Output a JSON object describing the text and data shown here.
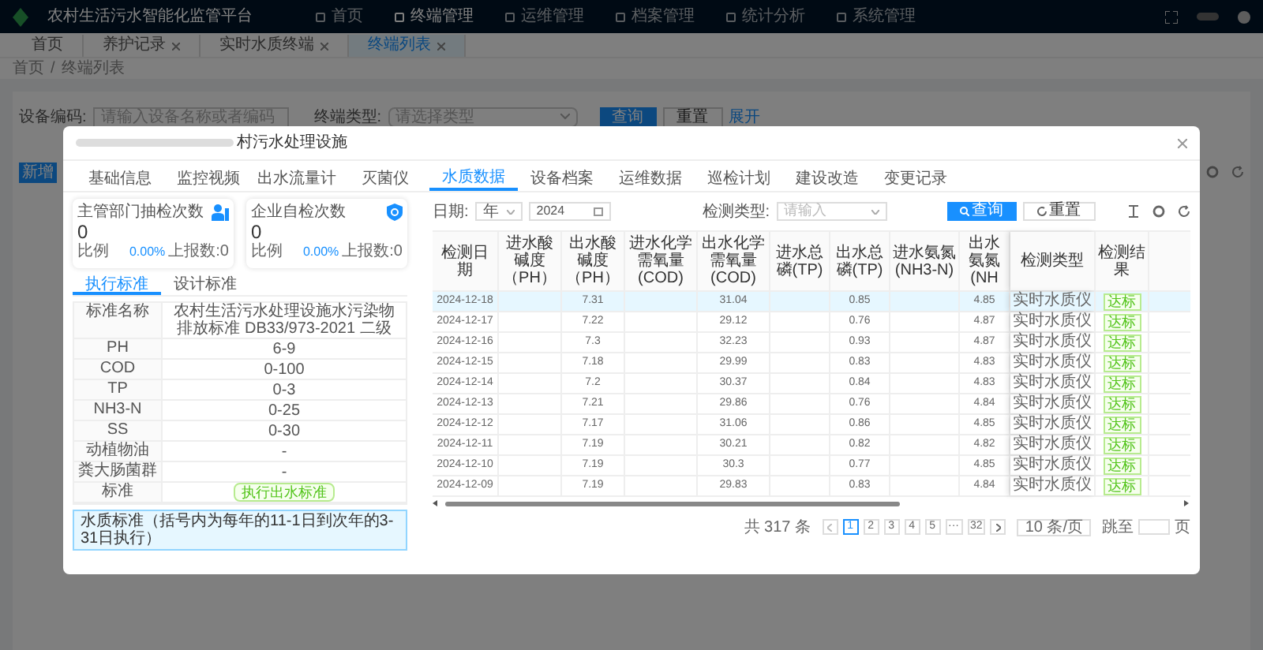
{
  "app": {
    "title": "农村生活污水智能化监管平台",
    "nav": [
      {
        "label": "首页",
        "selected": false
      },
      {
        "label": "终端管理",
        "selected": true
      },
      {
        "label": "运维管理",
        "selected": false
      },
      {
        "label": "档案管理",
        "selected": false
      },
      {
        "label": "统计分析",
        "selected": false
      },
      {
        "label": "系统管理",
        "selected": false
      }
    ]
  },
  "page_tabs": [
    {
      "label": "首页",
      "closable": false,
      "selected": false
    },
    {
      "label": "养护记录",
      "closable": true,
      "selected": false
    },
    {
      "label": "实时水质终端",
      "closable": true,
      "selected": false
    },
    {
      "label": "终端列表",
      "closable": true,
      "selected": true
    }
  ],
  "breadcrumb": {
    "items": [
      "首页",
      "终端列表"
    ],
    "separator": "/"
  },
  "filters": [
    {
      "label": "设备编码:",
      "placeholder": "请输入设备名称或者编码",
      "kind": "text"
    },
    {
      "label": "终端类型:",
      "placeholder": "请选择类型",
      "kind": "select"
    }
  ],
  "filter_buttons": {
    "search": "查询",
    "reset": "重置",
    "expand": "展开"
  },
  "add_button": "新增",
  "modal": {
    "title": "村污水处理设施",
    "tabs": [
      {
        "label": "基础信息",
        "selected": false
      },
      {
        "label": "监控视频",
        "selected": false
      },
      {
        "label": "出水流量计",
        "selected": false
      },
      {
        "label": "灭菌仪",
        "selected": false
      },
      {
        "label": "水质数据",
        "selected": true
      },
      {
        "label": "设备档案",
        "selected": false
      },
      {
        "label": "运维数据",
        "selected": false
      },
      {
        "label": "巡检计划",
        "selected": false
      },
      {
        "label": "建设改造",
        "selected": false
      },
      {
        "label": "变更记录",
        "selected": false
      }
    ],
    "stat_cards": [
      {
        "title": "主管部门抽检次数",
        "value": "0",
        "ratio_label": "比例",
        "ratio": "0.00%",
        "reported": "上报数:0"
      },
      {
        "title": "企业自检次数",
        "value": "0",
        "ratio_label": "比例",
        "ratio": "0.00%",
        "reported": "上报数:0"
      }
    ],
    "standard_tabs": [
      {
        "label": "执行标准",
        "selected": true
      },
      {
        "label": "设计标准",
        "selected": false
      }
    ],
    "standards": [
      {
        "label": "标准名称",
        "value": "农村生活污水处理设施水污染物排放标准 DB33/973-2021 二级",
        "kind": "text"
      },
      {
        "label": "PH",
        "value": "6-9",
        "kind": "text"
      },
      {
        "label": "COD",
        "value": "0-100",
        "kind": "text"
      },
      {
        "label": "TP",
        "value": "0-3",
        "kind": "text"
      },
      {
        "label": "NH3-N",
        "value": "0-25",
        "kind": "text"
      },
      {
        "label": "SS",
        "value": "0-30",
        "kind": "text"
      },
      {
        "label": "动植物油",
        "value": "-",
        "kind": "text"
      },
      {
        "label": "粪大肠菌群",
        "value": "-",
        "kind": "text"
      },
      {
        "label": "标准",
        "value": "执行出水标准",
        "kind": "tag"
      }
    ],
    "note": "水质标准（括号内为每年的11-1日到次年的3-31日执行）",
    "query": {
      "date_label": "日期:",
      "period": "年",
      "year": "2024",
      "type_label": "检测类型:",
      "type_placeholder": "请输入",
      "search": "查询",
      "reset": "重置"
    },
    "columns": [
      "检测日期",
      "进水酸碱度（PH）",
      "出水酸碱度（PH）",
      "进水化学需氧量(COD)",
      "出水化学需氧量(COD)",
      "进水总磷(TP)",
      "出水总磷(TP)",
      "进水氨氮(NH3-N)",
      "出水氨氮(NH",
      "检测类型",
      "检测结果"
    ],
    "rows": [
      {
        "cells": [
          "2024-12-18",
          "",
          "7.31",
          "",
          "31.04",
          "",
          "0.85",
          "",
          "4.85",
          "实时水质仪",
          "达标"
        ],
        "selected": true
      },
      {
        "cells": [
          "2024-12-17",
          "",
          "7.22",
          "",
          "29.12",
          "",
          "0.76",
          "",
          "4.87",
          "实时水质仪",
          "达标"
        ],
        "selected": false
      },
      {
        "cells": [
          "2024-12-16",
          "",
          "7.3",
          "",
          "32.23",
          "",
          "0.93",
          "",
          "4.87",
          "实时水质仪",
          "达标"
        ],
        "selected": false
      },
      {
        "cells": [
          "2024-12-15",
          "",
          "7.18",
          "",
          "29.99",
          "",
          "0.83",
          "",
          "4.83",
          "实时水质仪",
          "达标"
        ],
        "selected": false
      },
      {
        "cells": [
          "2024-12-14",
          "",
          "7.2",
          "",
          "30.37",
          "",
          "0.84",
          "",
          "4.83",
          "实时水质仪",
          "达标"
        ],
        "selected": false
      },
      {
        "cells": [
          "2024-12-13",
          "",
          "7.21",
          "",
          "29.86",
          "",
          "0.76",
          "",
          "4.84",
          "实时水质仪",
          "达标"
        ],
        "selected": false
      },
      {
        "cells": [
          "2024-12-12",
          "",
          "7.17",
          "",
          "31.06",
          "",
          "0.86",
          "",
          "4.85",
          "实时水质仪",
          "达标"
        ],
        "selected": false
      },
      {
        "cells": [
          "2024-12-11",
          "",
          "7.19",
          "",
          "30.21",
          "",
          "0.82",
          "",
          "4.82",
          "实时水质仪",
          "达标"
        ],
        "selected": false
      },
      {
        "cells": [
          "2024-12-10",
          "",
          "7.19",
          "",
          "30.3",
          "",
          "0.77",
          "",
          "4.85",
          "实时水质仪",
          "达标"
        ],
        "selected": false
      },
      {
        "cells": [
          "2024-12-09",
          "",
          "7.19",
          "",
          "29.83",
          "",
          "0.83",
          "",
          "4.84",
          "实时水质仪",
          "达标"
        ],
        "selected": false
      }
    ],
    "pagination": {
      "total": "共 317 条",
      "pages": [
        {
          "label": "1",
          "selected": true
        },
        {
          "label": "2",
          "selected": false
        },
        {
          "label": "3",
          "selected": false
        },
        {
          "label": "4",
          "selected": false
        },
        {
          "label": "5",
          "selected": false
        },
        {
          "label": "···",
          "selected": false
        },
        {
          "label": "32",
          "selected": false
        }
      ],
      "page_size": "10 条/页",
      "jump_label": "跳至",
      "jump_suffix": "页"
    }
  }
}
